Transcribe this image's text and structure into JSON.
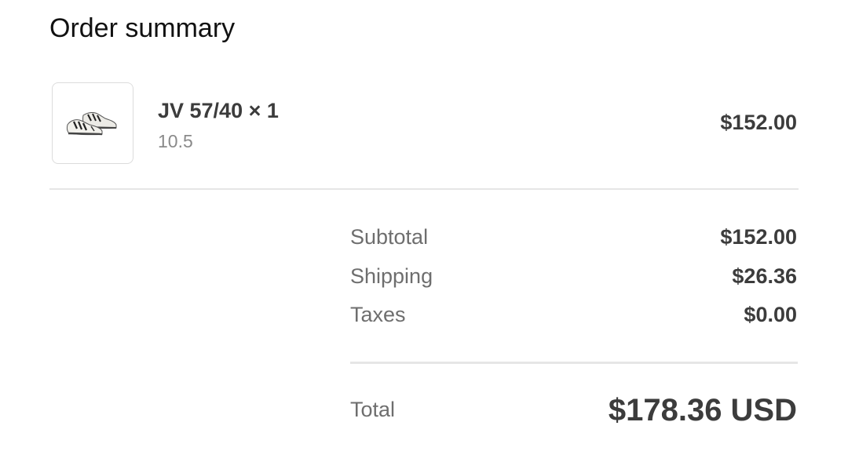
{
  "order_summary": {
    "title": "Order summary",
    "item": {
      "image_icon": "sneaker-image",
      "name": "JV 57/40 × 1",
      "variant": "10.5",
      "price": "$152.00"
    },
    "subtotal": {
      "label": "Subtotal",
      "value": "$152.00"
    },
    "shipping": {
      "label": "Shipping",
      "value": "$26.36"
    },
    "taxes": {
      "label": "Taxes",
      "value": "$0.00"
    },
    "total": {
      "label": "Total",
      "value": "$178.36 USD"
    }
  },
  "colors": {
    "text_primary": "#3c3c3c",
    "text_secondary": "#6e6e6e",
    "divider": "#e6e6e6"
  }
}
